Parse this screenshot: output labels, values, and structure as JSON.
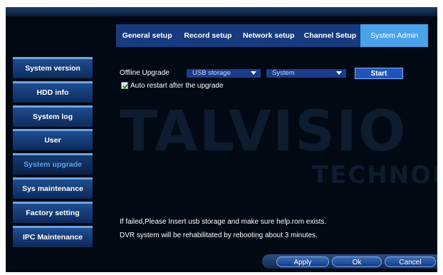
{
  "tabs": [
    {
      "label": "General setup"
    },
    {
      "label": "Record setup"
    },
    {
      "label": "Network setup"
    },
    {
      "label": "Channel Setup"
    },
    {
      "label": "System Admin"
    }
  ],
  "sidebar": {
    "items": [
      {
        "label": "System version"
      },
      {
        "label": "HDD info"
      },
      {
        "label": "System log"
      },
      {
        "label": "User"
      },
      {
        "label": "System upgrade"
      },
      {
        "label": "Sys maintenance"
      },
      {
        "label": "Factory setting"
      },
      {
        "label": "IPC Maintenance"
      }
    ],
    "active_index": 4
  },
  "upgrade": {
    "label": "Offline Upgrade",
    "source_value": "USB storage",
    "target_value": "System",
    "start_label": "Start",
    "auto_restart_label": "Auto restart after the upgrade",
    "auto_restart_checked": true
  },
  "messages": {
    "line1": "If failed,Please Insert usb storage and make sure help.rom exists.",
    "line2": "DVR system will be rehabilitated by rebooting about 3 minutes."
  },
  "footer": {
    "apply_label": "Apply",
    "ok_label": "Ok",
    "cancel_label": "Cancel"
  },
  "watermark": {
    "main": "TALVISIO",
    "sub": "TECHNOLO"
  }
}
